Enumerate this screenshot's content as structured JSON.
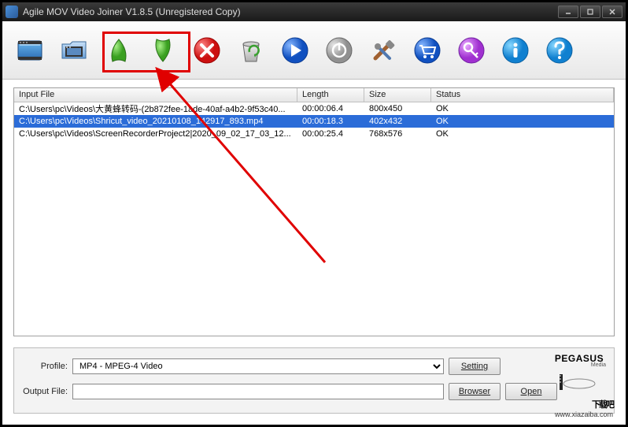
{
  "window": {
    "title": "Agile MOV Video Joiner V1.8.5 (Unregistered Copy)"
  },
  "toolbar": {
    "items": [
      {
        "name": "add-file",
        "label": "Add File"
      },
      {
        "name": "add-folder",
        "label": "Add Folder"
      },
      {
        "name": "move-up",
        "label": "Move Up"
      },
      {
        "name": "move-down",
        "label": "Move Down"
      },
      {
        "name": "remove",
        "label": "Remove"
      },
      {
        "name": "clear",
        "label": "Clear"
      },
      {
        "name": "start",
        "label": "Start"
      },
      {
        "name": "stop",
        "label": "Stop"
      },
      {
        "name": "settings",
        "label": "Settings"
      },
      {
        "name": "buy",
        "label": "Buy"
      },
      {
        "name": "register",
        "label": "Register"
      },
      {
        "name": "about",
        "label": "About"
      },
      {
        "name": "help",
        "label": "Help"
      }
    ]
  },
  "table": {
    "headers": {
      "file": "Input File",
      "length": "Length",
      "size": "Size",
      "status": "Status"
    },
    "rows": [
      {
        "file": "C:\\Users\\pc\\Videos\\大黄蜂转码-(2b872fee-1ade-40af-a4b2-9f53c40...",
        "length": "00:00:06.4",
        "size": "800x450",
        "status": "OK",
        "selected": false
      },
      {
        "file": "C:\\Users\\pc\\Videos\\Shricut_video_20210108_142917_893.mp4",
        "length": "00:00:18.3",
        "size": "402x432",
        "status": "OK",
        "selected": true
      },
      {
        "file": "C:\\Users\\pc\\Videos\\ScreenRecorderProject2|2020_09_02_17_03_12...",
        "length": "00:00:25.4",
        "size": "768x576",
        "status": "OK",
        "selected": false
      }
    ]
  },
  "form": {
    "profile_label": "Profile:",
    "profile_value": "MP4 - MPEG-4 Video",
    "outputfile_label": "Output File:",
    "outputfile_value": "",
    "setting_btn": "Setting",
    "browser_btn": "Browser",
    "open_btn": "Open"
  },
  "branding": {
    "pegasus": "PEGASUS",
    "media": "Media",
    "watermark_main": "下载吧",
    "watermark_url": "www.xiazaiba.com"
  }
}
